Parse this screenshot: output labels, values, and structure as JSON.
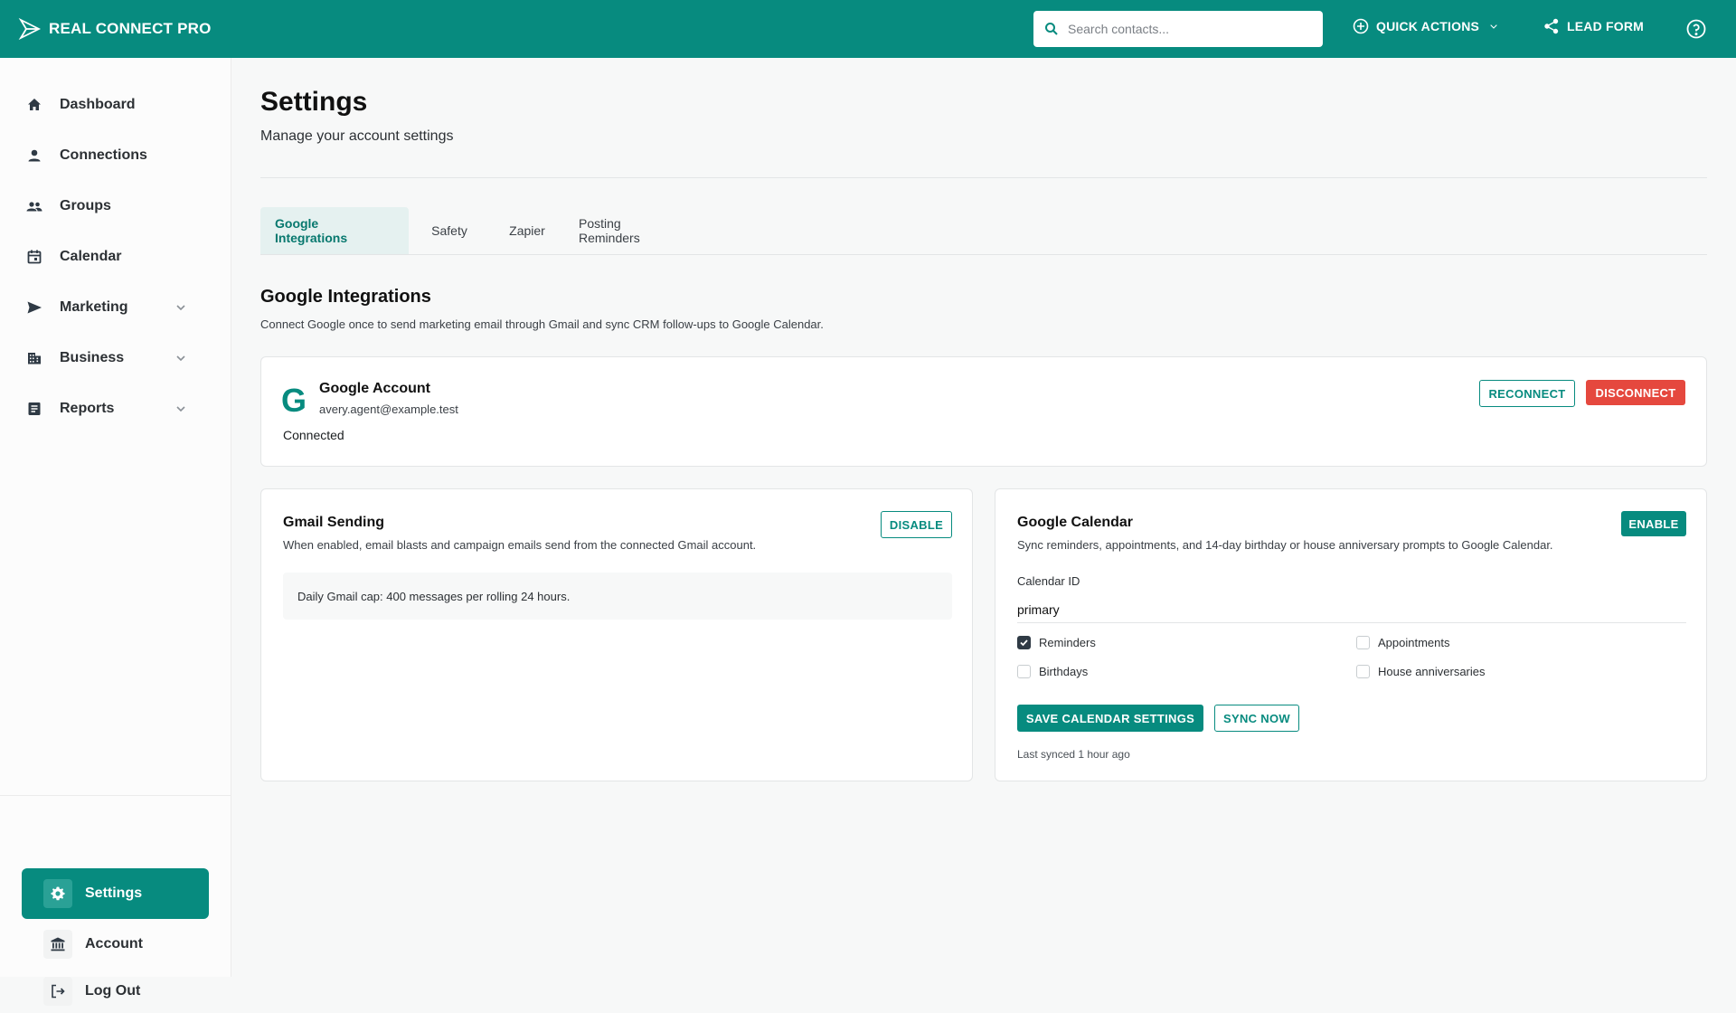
{
  "app": {
    "name": "REAL CONNECT PRO"
  },
  "topbar": {
    "search_placeholder": "Search contacts...",
    "quick_actions": "QUICK ACTIONS",
    "lead_form": "LEAD FORM"
  },
  "sidebar": {
    "items": [
      {
        "label": "Dashboard"
      },
      {
        "label": "Connections"
      },
      {
        "label": "Groups"
      },
      {
        "label": "Calendar"
      },
      {
        "label": "Marketing"
      },
      {
        "label": "Business"
      },
      {
        "label": "Reports"
      }
    ],
    "bottom": [
      {
        "label": "Settings"
      },
      {
        "label": "Account"
      },
      {
        "label": "Log Out"
      }
    ]
  },
  "page": {
    "title": "Settings",
    "subtitle": "Manage your account settings"
  },
  "tabs": [
    {
      "label": "Google Integrations"
    },
    {
      "label": "Safety"
    },
    {
      "label": "Zapier"
    },
    {
      "label": "Posting Reminders"
    }
  ],
  "section": {
    "title": "Google Integrations",
    "description": "Connect Google once to send marketing email through Gmail and sync CRM follow-ups to Google Calendar."
  },
  "account": {
    "logo_letter": "G",
    "name": "Google Account",
    "email": "avery.agent@example.test",
    "status": "Connected",
    "reconnect": "RECONNECT",
    "disconnect": "DISCONNECT"
  },
  "gmail": {
    "title": "Gmail Sending",
    "description": "When enabled, email blasts and campaign emails send from the connected Gmail account.",
    "button": "DISABLE",
    "cap": "Daily Gmail cap: 400 messages per rolling 24 hours."
  },
  "calendar": {
    "title": "Google Calendar",
    "description": "Sync reminders, appointments, and 14-day birthday or house anniversary prompts to Google Calendar.",
    "button": "ENABLE",
    "id_label": "Calendar ID",
    "id_value": "primary",
    "options": [
      {
        "label": "Reminders",
        "checked": true
      },
      {
        "label": "Appointments",
        "checked": false
      },
      {
        "label": "Birthdays",
        "checked": false
      },
      {
        "label": "House anniversaries",
        "checked": false
      }
    ],
    "save": "SAVE CALENDAR SETTINGS",
    "sync": "SYNC NOW",
    "last_synced": "Last synced 1 hour ago"
  },
  "colors": {
    "brand": "#078b7f",
    "danger": "#e5483e"
  }
}
